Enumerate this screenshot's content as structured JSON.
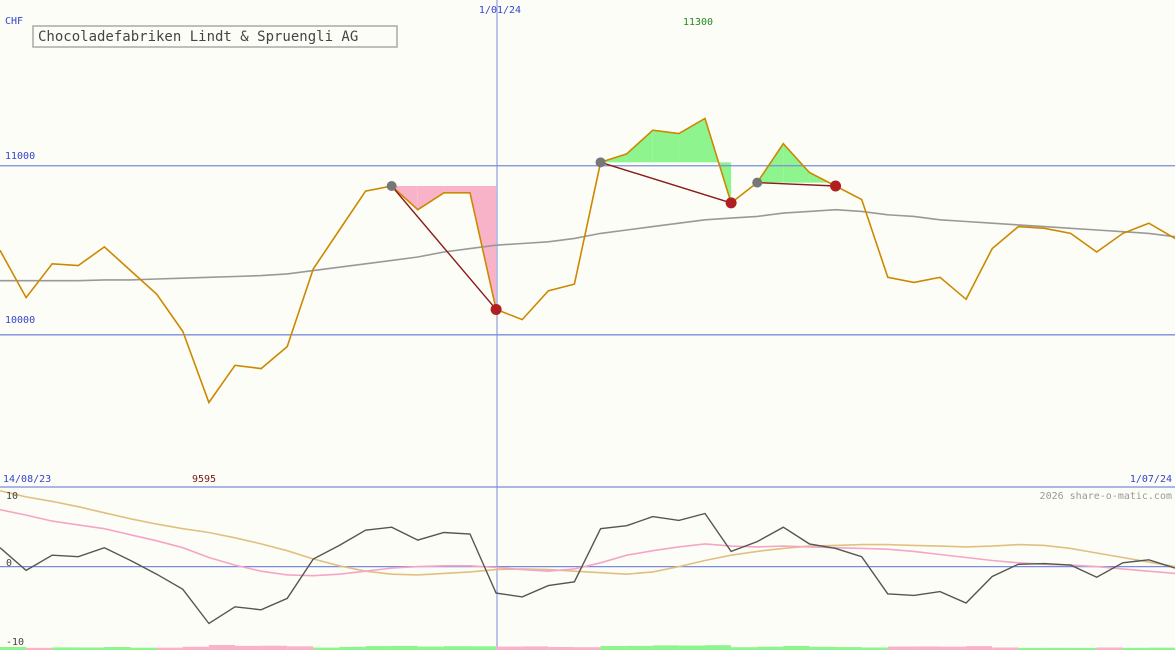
{
  "chart_data": [
    {
      "type": "line",
      "title": "Chocoladefabriken Lindt & Spruengli AG",
      "currency_label": "CHF",
      "top_marker_label": "1/01/24",
      "max_label": "11300",
      "min_label": "9595",
      "date_start": "14/08/23",
      "date_end": "1/07/24",
      "y_ticks": [
        {
          "value": 11000,
          "label": "11000"
        },
        {
          "value": 10000,
          "label": "10000"
        }
      ],
      "ylim": [
        9100,
        11980
      ],
      "colors": {
        "price": "#cc8800",
        "moving_average": "#999999",
        "gridline": "#7b8bdb",
        "trend_line": "#8b1a1a",
        "gain_fill": "#8ef58e",
        "loss_fill": "#f9b3c8",
        "max_label": "#228822",
        "min_label": "#7a1a1a",
        "axis_text": "#3344cc"
      },
      "series": [
        {
          "key": "price",
          "values": [
            10500,
            10220,
            [
              10420
            ],
            10410,
            10520,
            10380,
            10240,
            10020,
            9600,
            9820,
            9800,
            9930,
            10390,
            10620,
            10850,
            10880,
            10740,
            10840,
            10840,
            10150,
            10090,
            10260,
            10300,
            11020,
            11070,
            11210,
            11190,
            11280,
            10780,
            10900,
            11130,
            10960,
            10880,
            10800,
            10340,
            10310,
            10340,
            10210,
            10510,
            10640,
            10630,
            10600,
            10490,
            10600,
            10660,
            10570
          ]
        },
        {
          "key": "moving_average",
          "values": [
            10320,
            10320,
            10320,
            10320,
            10325,
            10325,
            10330,
            10335,
            10340,
            10345,
            10350,
            10360,
            10380,
            10400,
            10420,
            10440,
            10460,
            10490,
            10510,
            10530,
            10540,
            10550,
            10570,
            10600,
            10620,
            10640,
            10660,
            10680,
            10690,
            10700,
            10720,
            10730,
            10740,
            10730,
            10710,
            10700,
            10680,
            10670,
            10660,
            10650,
            10640,
            10630,
            10620,
            10610,
            10600,
            10580
          ]
        }
      ]
    },
    {
      "type": "line",
      "title": "",
      "copyright": "2026 share-o-matic.com",
      "y_ticks": [
        {
          "value": 10,
          "label": "10"
        },
        {
          "value": 0,
          "label": "0"
        },
        {
          "value": -10,
          "label": "-10"
        }
      ],
      "ylim": [
        -11,
        10.5
      ],
      "colors": {
        "oscillator": "#555555",
        "fast_average": "#f4a6c6",
        "slow_average": "#e0c080"
      },
      "series": [
        {
          "key": "oscillator",
          "values": [
            2.5,
            -0.5,
            1.5,
            1.3,
            2.5,
            0.8,
            -1.0,
            -3.0,
            -7.5,
            -5.3,
            -5.7,
            -4.2,
            1.0,
            2.8,
            4.8,
            5.2,
            3.5,
            4.5,
            4.3,
            -3.5,
            -4.0,
            -2.5,
            -2.0,
            5.0,
            5.4,
            6.6,
            6.1,
            7.0,
            2.0,
            3.3,
            5.2,
            3.0,
            2.4,
            1.3,
            -3.6,
            -3.8,
            -3.3,
            -4.8,
            -1.3,
            0.3,
            0.4,
            0.2,
            -1.4,
            0.5,
            0.9,
            -0.2
          ]
        },
        {
          "key": "fast_average",
          "values": [
            7.5,
            6.8,
            6.0,
            5.5,
            5.0,
            4.2,
            3.4,
            2.5,
            1.2,
            0.2,
            -0.6,
            -1.1,
            -1.2,
            -1.0,
            -0.6,
            -0.2,
            0.0,
            0.1,
            0.1,
            -0.1,
            -0.4,
            -0.6,
            -0.3,
            0.5,
            1.5,
            2.1,
            2.6,
            3.0,
            2.7,
            2.6,
            2.7,
            2.6,
            2.5,
            2.4,
            2.3,
            2.0,
            1.6,
            1.2,
            0.8,
            0.5,
            0.3,
            0.2,
            0.0,
            -0.3,
            -0.6,
            -0.9
          ]
        },
        {
          "key": "slow_average",
          "values": [
            10.0,
            9.2,
            8.6,
            7.9,
            7.1,
            6.3,
            5.6,
            5.0,
            4.5,
            3.8,
            3.0,
            2.1,
            1.0,
            0.1,
            -0.6,
            -1.0,
            -1.1,
            -0.9,
            -0.7,
            -0.4,
            -0.3,
            -0.4,
            -0.6,
            -0.8,
            -1.0,
            -0.7,
            0.0,
            0.8,
            1.5,
            2.0,
            2.4,
            2.7,
            2.8,
            2.9,
            2.9,
            2.8,
            2.7,
            2.6,
            2.7,
            2.9,
            2.8,
            2.4,
            1.8,
            1.2,
            0.6,
            0.0
          ]
        }
      ]
    }
  ]
}
